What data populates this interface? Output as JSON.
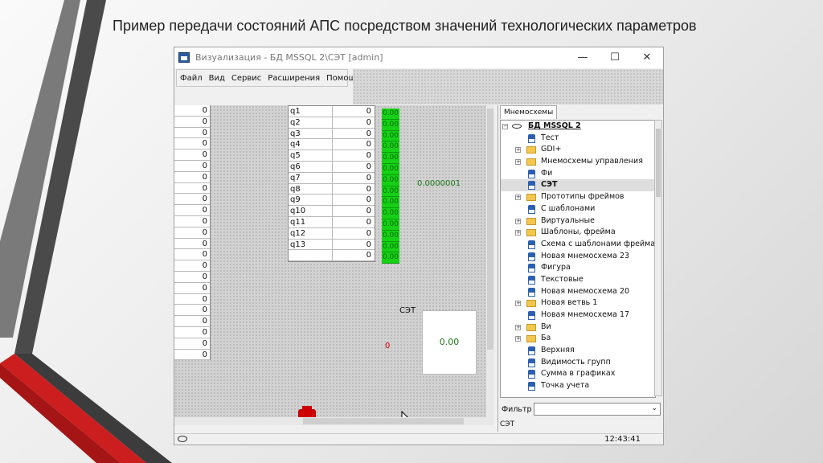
{
  "slide": {
    "title": "Пример передачи состояний АПС посредством значений технологических параметров"
  },
  "window": {
    "title": "Визуализация - БД MSSQL 2\\СЭТ [admin]",
    "controls": {
      "minimize": "—",
      "maximize": "☐",
      "close": "✕"
    }
  },
  "menu": [
    "Файл",
    "Вид",
    "Сервис",
    "Расширения",
    "Помощь"
  ],
  "left_grid": [
    "0",
    "0",
    "0",
    "0",
    "0",
    "0",
    "0",
    "0",
    "0",
    "0",
    "0",
    "0",
    "0",
    "0",
    "0",
    "0",
    "0",
    "0",
    "0",
    "0",
    "0",
    "0",
    "0"
  ],
  "q_table": [
    {
      "name": "q1",
      "value": "0"
    },
    {
      "name": "q2",
      "value": "0"
    },
    {
      "name": "q3",
      "value": "0"
    },
    {
      "name": "q4",
      "value": "0"
    },
    {
      "name": "q5",
      "value": "0"
    },
    {
      "name": "q6",
      "value": "0"
    },
    {
      "name": "q7",
      "value": "0"
    },
    {
      "name": "q8",
      "value": "0"
    },
    {
      "name": "q9",
      "value": "0"
    },
    {
      "name": "q10",
      "value": "0"
    },
    {
      "name": "q11",
      "value": "0"
    },
    {
      "name": "q12",
      "value": "0"
    },
    {
      "name": "q13",
      "value": "0"
    },
    {
      "name": "",
      "value": "0"
    }
  ],
  "green_indicators": [
    "0.00",
    "0.00",
    "0.00",
    "0.00",
    "0.00",
    "0.00",
    "0.00",
    "0.00",
    "0.00",
    "0.00",
    "0.00",
    "0.00",
    "0.00",
    "0.00"
  ],
  "canvas": {
    "readout": "0.0000001",
    "set_label": "СЭТ",
    "red_zero": "0",
    "box_value": "0.00"
  },
  "status": {
    "time": "12:43:41"
  },
  "panel": {
    "tab": "Мнемосхемы",
    "tree": [
      {
        "label": "БД MSSQL 2",
        "type": "root",
        "expander": "−",
        "level": 0
      },
      {
        "label": "Тест",
        "type": "page",
        "level": 1
      },
      {
        "label": "GDI+",
        "type": "folder",
        "expander": "+",
        "level": 1
      },
      {
        "label": "Мнемосхемы управления",
        "type": "folder",
        "expander": "+",
        "level": 1
      },
      {
        "label": "Фи",
        "type": "page",
        "level": 1
      },
      {
        "label": "СЭТ",
        "type": "page",
        "level": 1,
        "selected": true
      },
      {
        "label": "Прототипы фреймов",
        "type": "folder",
        "expander": "+",
        "level": 1
      },
      {
        "label": "С шаблонами",
        "type": "page",
        "level": 1
      },
      {
        "label": "Виртуальные",
        "type": "folder",
        "expander": "+",
        "level": 1
      },
      {
        "label": "Шаблоны, фрейма",
        "type": "folder",
        "expander": "+",
        "level": 1
      },
      {
        "label": "Схема с шаблонами фреймами",
        "type": "page",
        "level": 1
      },
      {
        "label": "Новая мнемосхема 23",
        "type": "page",
        "level": 1
      },
      {
        "label": "Фигура",
        "type": "page",
        "level": 1
      },
      {
        "label": "Текстовые",
        "type": "page",
        "level": 1
      },
      {
        "label": "Новая мнемосхема 20",
        "type": "page",
        "level": 1
      },
      {
        "label": "Новая ветвь 1",
        "type": "folder",
        "expander": "+",
        "level": 1
      },
      {
        "label": "Новая мнемосхема 17",
        "type": "page",
        "level": 1
      },
      {
        "label": "Ви",
        "type": "folder",
        "expander": "+",
        "level": 1
      },
      {
        "label": "Ба",
        "type": "folder",
        "expander": "+",
        "level": 1
      },
      {
        "label": "Верхняя",
        "type": "page",
        "level": 1
      },
      {
        "label": "Видимость групп",
        "type": "page",
        "level": 1
      },
      {
        "label": "Сумма в графиках",
        "type": "page",
        "level": 1
      },
      {
        "label": "Точка учета",
        "type": "page",
        "level": 1
      }
    ],
    "filter_label": "Фильтр",
    "filter_value": "",
    "status": "СЭТ"
  },
  "colors": {
    "indicator_green": "#16d016",
    "accent_red": "#c00000",
    "deco_dark": "#3c3c3c"
  }
}
